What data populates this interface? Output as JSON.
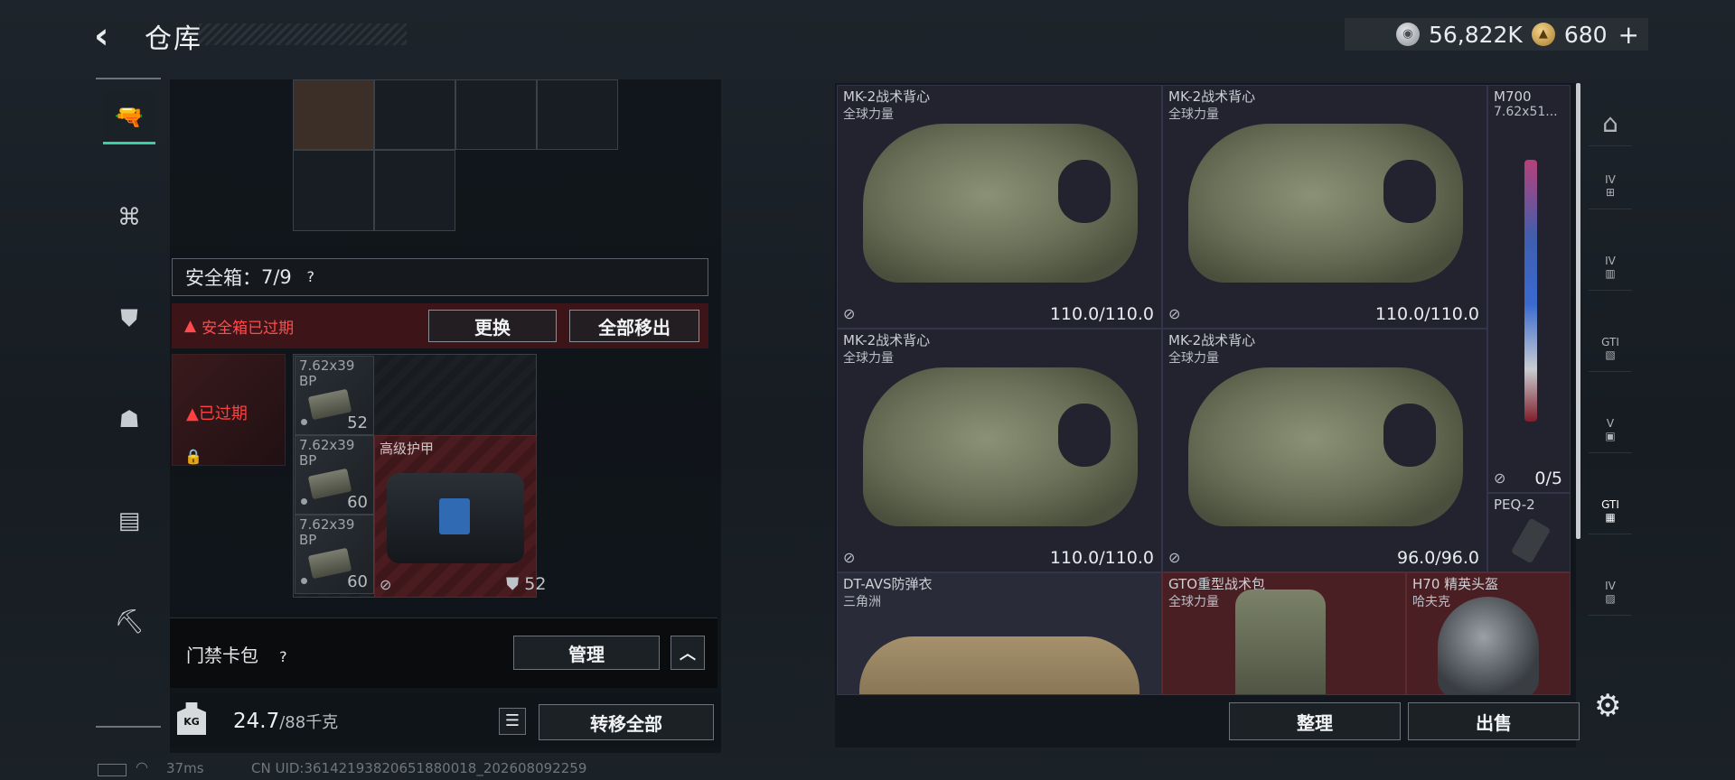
{
  "header": {
    "title": "仓库",
    "back_icon": "chevron-left-icon",
    "currency": [
      {
        "icon": "silver-coin-icon",
        "value": "56,822K"
      },
      {
        "icon": "gold-coin-icon",
        "value": "680"
      }
    ],
    "plus": "+"
  },
  "left_rail": {
    "items": [
      {
        "icon": "pistol-icon",
        "active": true
      },
      {
        "icon": "vest-icon",
        "active": false
      },
      {
        "icon": "armor-plate-icon",
        "active": false
      },
      {
        "icon": "backpack-icon",
        "active": false
      },
      {
        "icon": "case-icon",
        "active": false
      },
      {
        "icon": "toolbox-icon",
        "active": false
      }
    ]
  },
  "safe_box": {
    "header_label": "安全箱：",
    "capacity": "7/9",
    "help": "?",
    "expired_warning": "安全箱已过期",
    "replace_button": "更换",
    "remove_all_button": "全部移出",
    "case_expired_tag": "已过期",
    "items": [
      {
        "name": "7.62x39\nBP",
        "count": "52"
      },
      {
        "name": "7.62x39\nBP",
        "count": "60"
      },
      {
        "name": "7.62x39\nBP",
        "count": "60"
      }
    ],
    "armor": {
      "label": "高级护甲",
      "durability": "52"
    }
  },
  "card_pack": {
    "label": "门禁卡包",
    "help": "?",
    "manage_button": "管理",
    "collapse_icon": "chevron-up-icon"
  },
  "weight": {
    "icon_label": "KG",
    "current": "24.7",
    "max": "/88千克",
    "transfer_all_button": "转移全部"
  },
  "storage": {
    "slots": [
      {
        "name": "MK-2战术背心",
        "brand": "全球力量",
        "durability": "110.0/110.0"
      },
      {
        "name": "MK-2战术背心",
        "brand": "全球力量",
        "durability": "110.0/110.0"
      },
      {
        "name": "M700",
        "brand": "7.62x51...",
        "durability": "0/5"
      },
      {
        "name": "MK-2战术背心",
        "brand": "全球力量",
        "durability": "110.0/110.0"
      },
      {
        "name": "MK-2战术背心",
        "brand": "全球力量",
        "durability": "96.0/96.0"
      },
      {
        "name": "PEQ-2",
        "brand": "",
        "durability": ""
      },
      {
        "name": "DT-AVS防弹衣",
        "brand": "三角洲",
        "durability": ""
      },
      {
        "name": "GTO重型战术包",
        "brand": "全球力量",
        "durability": ""
      },
      {
        "name": "H70 精英头盔",
        "brand": "哈夫克",
        "durability": ""
      }
    ],
    "sort_button": "整理",
    "sell_button": "出售"
  },
  "right_rail": {
    "items": [
      {
        "icon": "home-icon",
        "label": ""
      },
      {
        "icon": "storage-iv-add-icon",
        "label": "IV"
      },
      {
        "icon": "storage-iv-icon",
        "label": "IV"
      },
      {
        "icon": "storage-gti-icon",
        "label": "GTI"
      },
      {
        "icon": "storage-v-icon",
        "label": "V"
      },
      {
        "icon": "storage-gti-active-icon",
        "label": "GTI"
      },
      {
        "icon": "storage-iv-2-icon",
        "label": "IV"
      }
    ],
    "settings_icon": "gear-icon"
  },
  "status": {
    "ping": "37ms",
    "uid": "CN UID:36142193820651880018_202608092259"
  }
}
